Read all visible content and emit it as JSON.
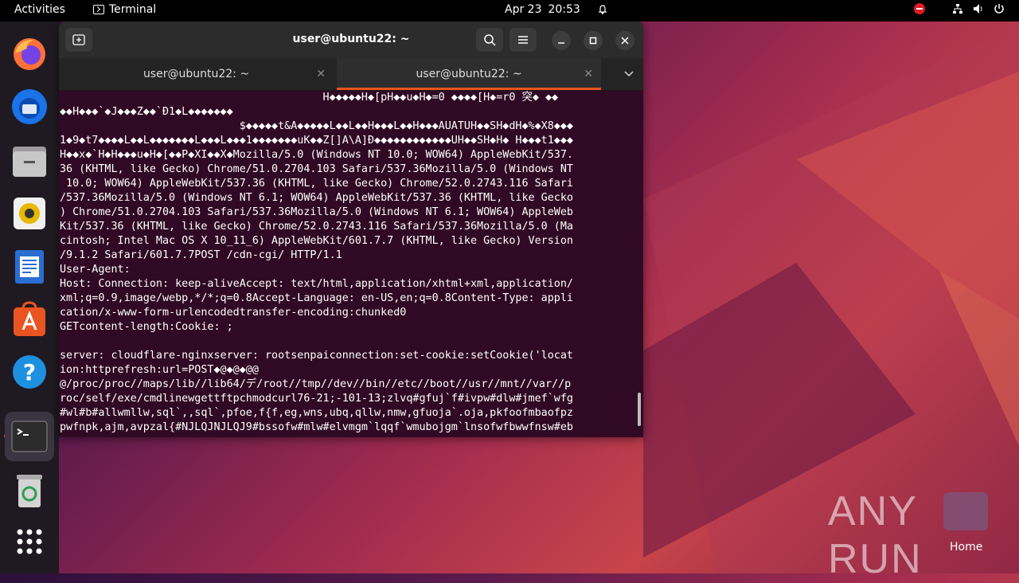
{
  "topbar": {
    "activities": "Activities",
    "app_name": "Terminal",
    "date": "Apr 23",
    "time": "20:53"
  },
  "window": {
    "title": "user@ubuntu22: ~",
    "tabs": [
      {
        "label": "user@ubuntu22: ~",
        "active": false
      },
      {
        "label": "user@ubuntu22: ~",
        "active": true
      }
    ]
  },
  "terminal": {
    "lines": [
      "                                         H◆◆◆◆◆H◆[pH◆◆u◆H◆=0 ◆◆◆◆[H◆=r0 突◆ ◆◆",
      "◆◆H◆◆◆`◆J◆◆◆Z◆◆`Ð1◆L◆◆◆◆◆◆◆",
      "                            $◆◆◆◆◆t&A◆◆◆◆◆L◆◆L◆◆H◆◆◆L◆◆H◆◆◆AUATUH◆◆SH◆dH◆%◆X8◆◆◆",
      "1◆9◆t7◆◆◆◆L◆◆L◆◆◆◆◆◆◆L◆◆◆L◆◆◆1◆◆◆◆◆◆◆uK◆◆Z[]A\\A]Ð◆◆◆◆◆◆◆◆◆◆◆◆UH◆◆SH◆H◆ H◆◆◆t1◆◆◆",
      "H◆◆x◆`H◆H◆◆◆u◆H◆[◆◆P◆XI◆◆X◆Mozilla/5.0 (Windows NT 10.0; WOW64) AppleWebKit/537.",
      "36 (KHTML, like Gecko) Chrome/51.0.2704.103 Safari/537.36Mozilla/5.0 (Windows NT",
      " 10.0; WOW64) AppleWebKit/537.36 (KHTML, like Gecko) Chrome/52.0.2743.116 Safari",
      "/537.36Mozilla/5.0 (Windows NT 6.1; WOW64) AppleWebKit/537.36 (KHTML, like Gecko",
      ") Chrome/51.0.2704.103 Safari/537.36Mozilla/5.0 (Windows NT 6.1; WOW64) AppleWeb",
      "Kit/537.36 (KHTML, like Gecko) Chrome/52.0.2743.116 Safari/537.36Mozilla/5.0 (Ma",
      "cintosh; Intel Mac OS X 10_11_6) AppleWebKit/601.7.7 (KHTML, like Gecko) Version",
      "/9.1.2 Safari/601.7.7POST /cdn-cgi/ HTTP/1.1",
      "User-Agent:",
      "Host: Connection: keep-aliveAccept: text/html,application/xhtml+xml,application/",
      "xml;q=0.9,image/webp,*/*;q=0.8Accept-Language: en-US,en;q=0.8Content-Type: appli",
      "cation/x-www-form-urlencodedtransfer-encoding:chunked0",
      "GETcontent-length:Cookie: ;",
      "",
      "server: cloudflare-nginxserver: rootsenpaiconnection:set-cookie:setCookie('locat",
      "ion:httprefresh:url=POST◆@◆@◆@@",
      "@/proc/proc//maps/lib//lib64/デ/root//tmp//dev//bin//etc//boot//usr//mnt//var//p",
      "roc/self/exe/cmdlinewgettftpchmodcurl76-21;-101-13;zlvq#gfuj`f#ivpw#dlw#jmef`wfg",
      "#wl#b#allwmllw,sql`,,sql`,pfoe,f{f,eg,wns,ubq,qllw,nmw,gfuoja`.oja,pkfoofmbaofpz",
      "pwfnpk,ajm,avpzal{#NJLQJNJLQJ9#bssofw#mlw#elvmgm`lqqf`wmubojgm`lnsofwfbwwfnsw#eb"
    ]
  },
  "desktop": {
    "watermark": "ANY RUN",
    "home_label": "Home"
  }
}
